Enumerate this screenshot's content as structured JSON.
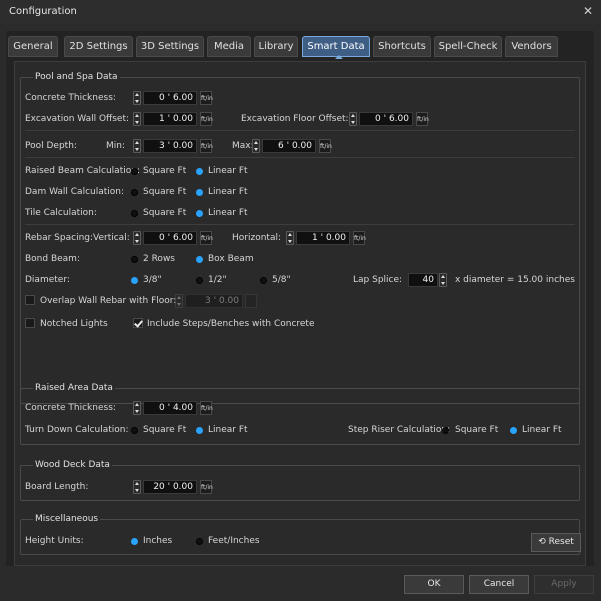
{
  "window": {
    "title": "Configuration"
  },
  "tabs": [
    "General",
    "2D Settings",
    "3D Settings",
    "Media",
    "Library",
    "Smart Data",
    "Shortcuts",
    "Spell-Check",
    "Vendors"
  ],
  "pool": {
    "title": "Pool and Spa Data",
    "concrete_thickness_label": "Concrete Thickness:",
    "concrete_thickness_value": "0 ' 6.00",
    "excavation_wall_label": "Excavation Wall Offset:",
    "excavation_wall_value": "1 ' 0.00",
    "excavation_floor_label": "Excavation Floor Offset:",
    "excavation_floor_value": "0 ' 6.00",
    "pool_depth_label": "Pool Depth:",
    "min_label": "Min:",
    "min_value": "3 ' 0.00",
    "max_label": "Max:",
    "max_value": "6 ' 0.00",
    "raised_beam_label": "Raised Beam Calculation:",
    "dam_wall_label": "Dam Wall Calculation:",
    "tile_label": "Tile Calculation:",
    "square_ft": "Square Ft",
    "linear_ft": "Linear Ft",
    "rebar_spacing_label": "Rebar Spacing:",
    "vertical_label": "Vertical:",
    "vertical_value": "0 ' 6.00",
    "horizontal_label": "Horizontal:",
    "horizontal_value": "1 ' 0.00",
    "bond_beam_label": "Bond Beam:",
    "two_rows": "2 Rows",
    "box_beam": "Box Beam",
    "diameter_label": "Diameter:",
    "d38": "3/8\"",
    "d12": "1/2\"",
    "d58": "5/8\"",
    "lap_splice_label": "Lap Splice:",
    "lap_splice_value": "40",
    "lap_splice_note": "x diameter = 15.00 inches",
    "overlap_label": "Overlap Wall Rebar with Floor:",
    "overlap_value": "3 ' 0.00",
    "notched_label": "Notched Lights",
    "include_label": "Include Steps/Benches with Concrete"
  },
  "raised": {
    "title": "Raised Area Data",
    "concrete_thickness_label": "Concrete Thickness:",
    "concrete_thickness_value": "0 ' 4.00",
    "turn_down_label": "Turn Down Calculation:",
    "square_ft": "Square Ft",
    "linear_ft": "Linear Ft",
    "step_riser_label": "Step Riser Calculation:"
  },
  "wood": {
    "title": "Wood Deck Data",
    "board_length_label": "Board Length:",
    "board_length_value": "20 ' 0.00"
  },
  "misc": {
    "title": "Miscellaneous",
    "height_units_label": "Height Units:",
    "inches": "Inches",
    "feet_inches": "Feet/Inches"
  },
  "unit_tip": "ft/in",
  "buttons": {
    "reset": "Reset",
    "ok": "OK",
    "cancel": "Cancel",
    "apply": "Apply"
  },
  "colors": {
    "accent": "#29a3ff",
    "active_tab": "#3e5e85"
  }
}
